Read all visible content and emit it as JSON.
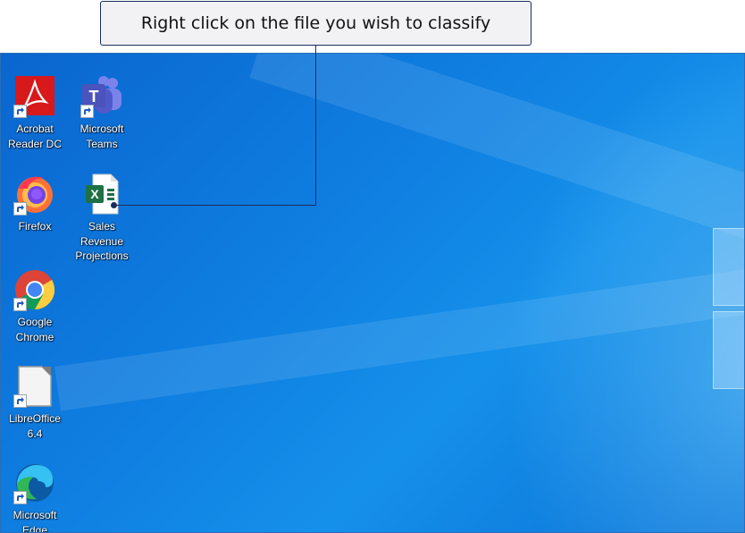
{
  "callout": {
    "text": "Right click on the file you wish to classify"
  },
  "desktop_icons": [
    {
      "id": "acrobat",
      "label": "Acrobat Reader DC",
      "icon": "acrobat-icon",
      "shortcut": true
    },
    {
      "id": "teams",
      "label": "Microsoft Teams",
      "icon": "teams-icon",
      "shortcut": true
    },
    {
      "id": "firefox",
      "label": "Firefox",
      "icon": "firefox-icon",
      "shortcut": true
    },
    {
      "id": "sales",
      "label": "Sales Revenue Projections",
      "icon": "excel-file-icon",
      "shortcut": false
    },
    {
      "id": "chrome",
      "label": "Google Chrome",
      "icon": "chrome-icon",
      "shortcut": true
    },
    {
      "id": "libreoffice",
      "label": "LibreOffice 6.4",
      "icon": "libreoffice-icon",
      "shortcut": true
    },
    {
      "id": "edge",
      "label": "Microsoft Edge",
      "icon": "edge-icon",
      "shortcut": true
    }
  ],
  "colors": {
    "desktop_blue": "#0f7ee0",
    "callout_border": "#1a2d5a",
    "acrobat_red": "#d7191b",
    "teams_purple": "#5059c9",
    "excel_green": "#1e7145"
  }
}
